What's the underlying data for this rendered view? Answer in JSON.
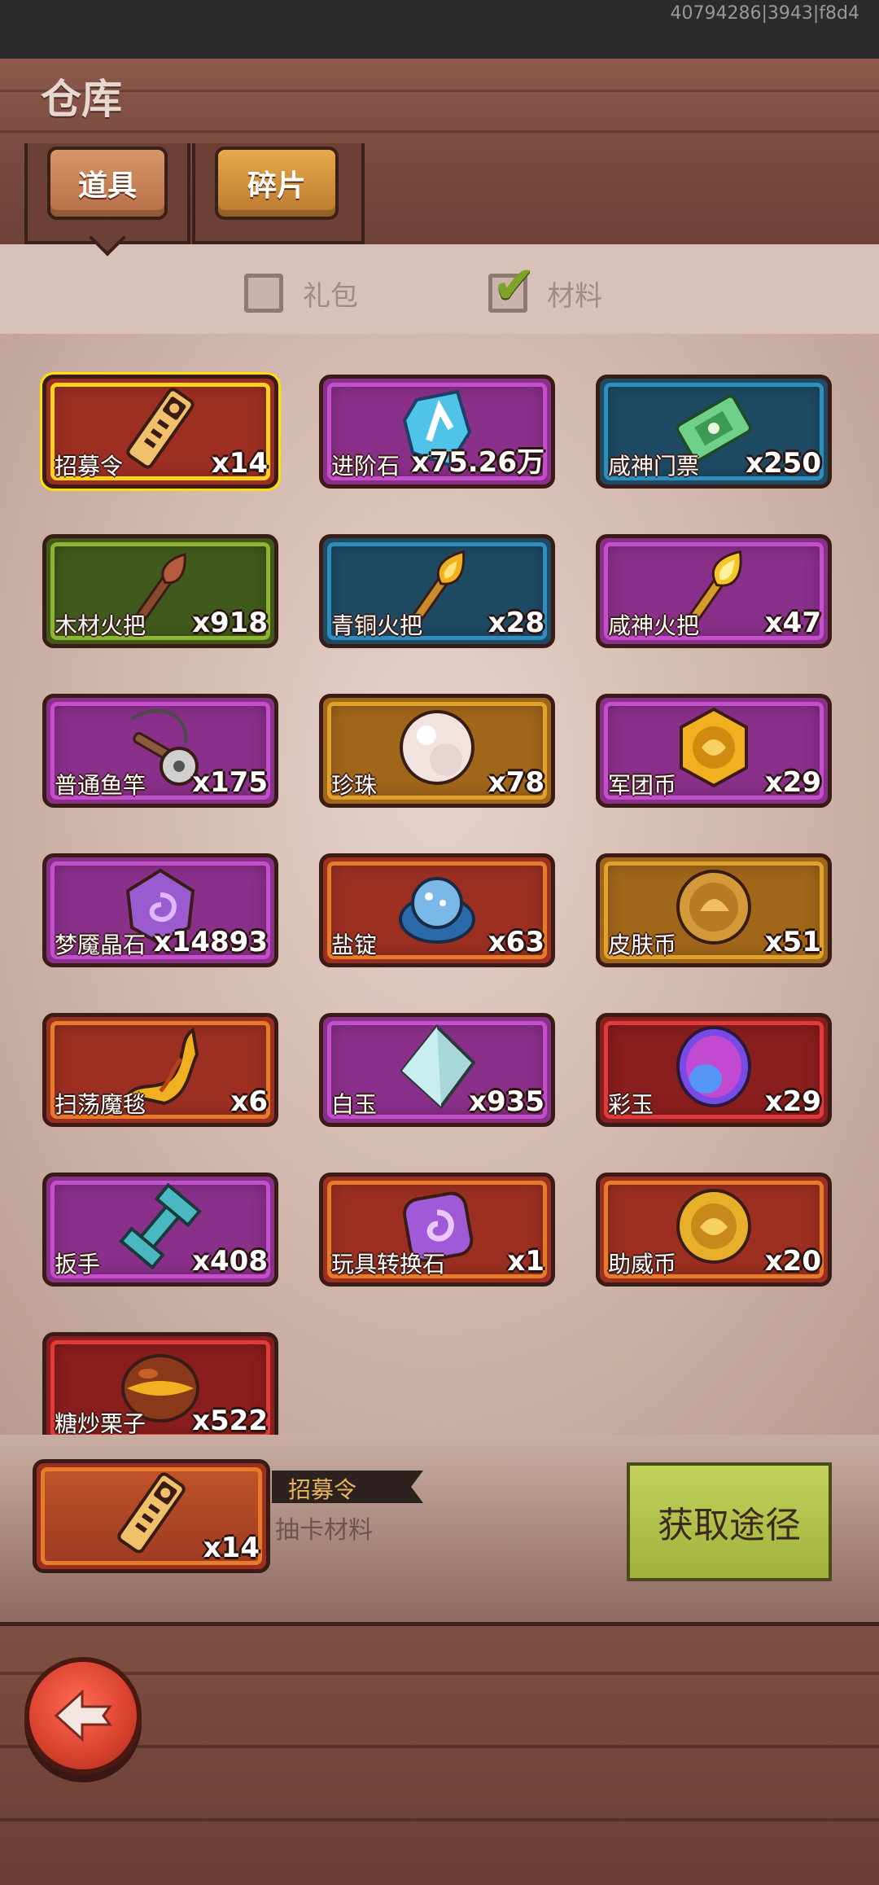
{
  "status_bar": {
    "build_id": "40794286|3943|f8d4"
  },
  "header": {
    "title": "仓库"
  },
  "tabs": [
    {
      "label": "道具",
      "active": true
    },
    {
      "label": "碎片",
      "active": false
    }
  ],
  "filters": [
    {
      "label": "礼包",
      "checked": false
    },
    {
      "label": "材料",
      "checked": true
    }
  ],
  "items": [
    {
      "name": "招募令",
      "count": "x14",
      "bg": "#9c2f22",
      "border": "#ffd21f",
      "icon": "recruit-token-icon"
    },
    {
      "name": "进阶石",
      "count": "x75.26万",
      "bg": "#8a2f8a",
      "border": "#c44fcb",
      "icon": "advance-stone-icon"
    },
    {
      "name": "咸神门票",
      "count": "x250",
      "bg": "#1e4a64",
      "border": "#2e8fbf",
      "icon": "ticket-icon"
    },
    {
      "name": "木材火把",
      "count": "x918",
      "bg": "#3f5a1c",
      "border": "#8fb42e",
      "icon": "wood-torch-icon"
    },
    {
      "name": "青铜火把",
      "count": "x28",
      "bg": "#1e4a64",
      "border": "#2e8fbf",
      "icon": "bronze-torch-icon"
    },
    {
      "name": "咸神火把",
      "count": "x47",
      "bg": "#8a2f8a",
      "border": "#c44fcb",
      "icon": "god-torch-icon"
    },
    {
      "name": "普通鱼竿",
      "count": "x175",
      "bg": "#8a2f8a",
      "border": "#c44fcb",
      "icon": "fishing-rod-icon"
    },
    {
      "name": "珍珠",
      "count": "x78",
      "bg": "#a0661a",
      "border": "#e0a22b",
      "icon": "pearl-icon"
    },
    {
      "name": "军团币",
      "count": "x29",
      "bg": "#8a2f8a",
      "border": "#c44fcb",
      "icon": "legion-coin-icon"
    },
    {
      "name": "梦魇晶石",
      "count": "x14893",
      "bg": "#8a2f8a",
      "border": "#c44fcb",
      "icon": "nightmare-crystal-icon"
    },
    {
      "name": "盐锭",
      "count": "x63",
      "bg": "#9c2f22",
      "border": "#e77c28",
      "icon": "salt-ingot-icon"
    },
    {
      "name": "皮肤币",
      "count": "x51",
      "bg": "#a0661a",
      "border": "#e0a22b",
      "icon": "skin-coin-icon"
    },
    {
      "name": "扫荡魔毯",
      "count": "x6",
      "bg": "#9c2f22",
      "border": "#e77c28",
      "icon": "magic-carpet-icon"
    },
    {
      "name": "白玉",
      "count": "x935",
      "bg": "#8a2f8a",
      "border": "#c44fcb",
      "icon": "white-jade-icon"
    },
    {
      "name": "彩玉",
      "count": "x29",
      "bg": "#8a1d1d",
      "border": "#e03a3a",
      "icon": "color-jade-icon"
    },
    {
      "name": "扳手",
      "count": "x408",
      "bg": "#8a2f8a",
      "border": "#c44fcb",
      "icon": "wrench-icon"
    },
    {
      "name": "玩具转换石",
      "count": "x1",
      "bg": "#9c2f22",
      "border": "#e77c28",
      "icon": "toy-stone-icon"
    },
    {
      "name": "助威币",
      "count": "x20",
      "bg": "#9c2f22",
      "border": "#e77c28",
      "icon": "cheer-coin-icon"
    },
    {
      "name": "糖炒栗子",
      "count": "x522",
      "bg": "#8a1d1d",
      "border": "#e03a3a",
      "icon": "chestnut-icon"
    }
  ],
  "detail": {
    "name": "招募令",
    "count": "x14",
    "description": "抽卡材料",
    "get_button": "获取途径"
  }
}
